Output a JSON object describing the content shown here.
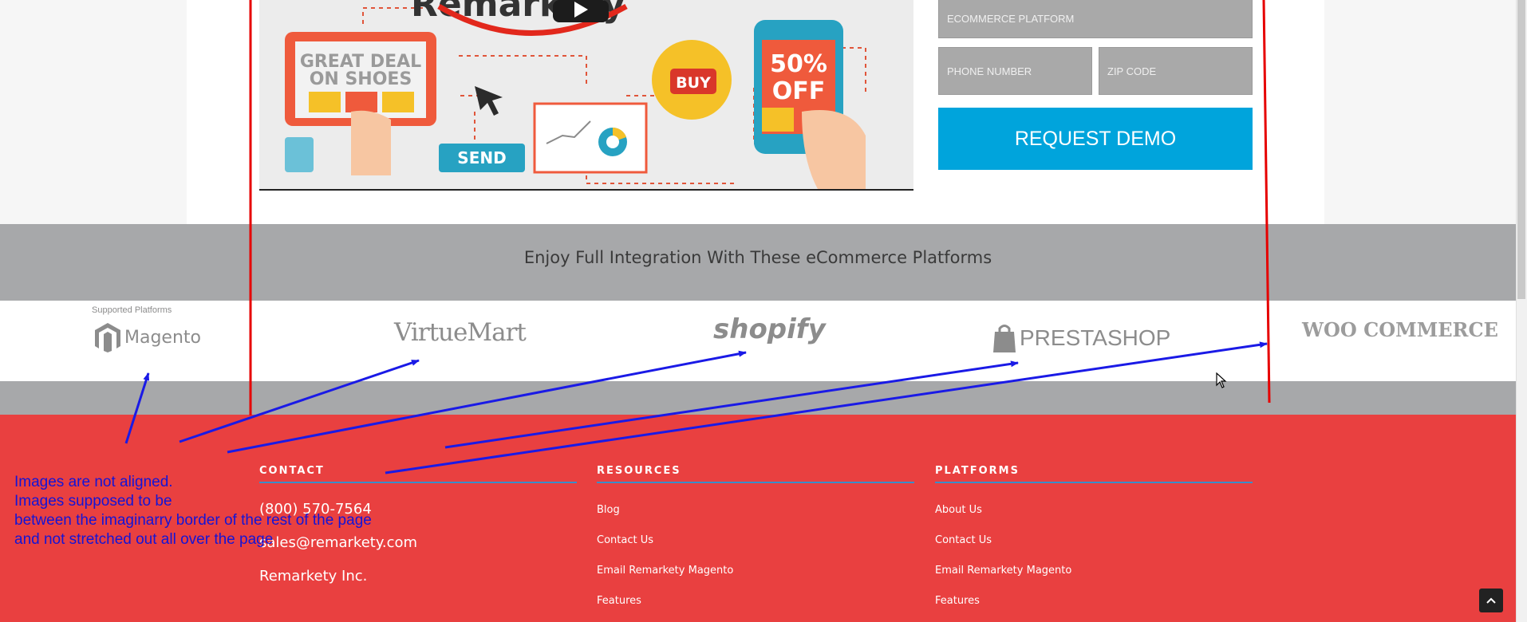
{
  "form": {
    "ecommerce_placeholder": "ECOMMERCE PLATFORM",
    "phone_placeholder": "PHONE NUMBER",
    "zip_placeholder": "ZIP CODE",
    "submit_label": "REQUEST DEMO"
  },
  "video": {
    "brand_text": "Remarkety",
    "shoe_text_1": "GREAT DEAL",
    "shoe_text_2": "ON SHOES",
    "buy_text": "BUY",
    "send_text": "SEND",
    "discount_text_1": "50%",
    "discount_text_2": "OFF"
  },
  "integration": {
    "title": "Enjoy Full Integration With These eCommerce Platforms",
    "supported_label": "Supported Platforms",
    "logos": [
      "Magento",
      "VirtueMart",
      "shopify",
      "PRESTASHOP",
      "WOO COMMERCE"
    ]
  },
  "footer": {
    "contact": {
      "heading": "CONTACT",
      "phone": "(800) 570-7564",
      "email": "sales@remarkety.com",
      "company": "Remarkety Inc."
    },
    "resources": {
      "heading": "RESOURCES",
      "links": [
        "Blog",
        "Contact Us",
        "Email Remarkety Magento",
        "Features"
      ]
    },
    "platforms": {
      "heading": "PLATFORMS",
      "links": [
        "About Us",
        "Contact Us",
        "Email Remarkety Magento",
        "Features"
      ]
    }
  },
  "annotation": {
    "text": "Images are not aligned.\nImages supposed to be\nbetween the imaginarry border of the rest of the page\nand not stretched out all over the page",
    "color": "#1414d6",
    "line_color": "#e60000"
  },
  "colors": {
    "accent": "#00a4dc",
    "footer_bg": "#e94040",
    "band_bg": "#a7a8aa"
  },
  "icons": [
    "play-icon",
    "cursor-icon",
    "chevron-up-icon",
    "shopping-bag-icon"
  ]
}
